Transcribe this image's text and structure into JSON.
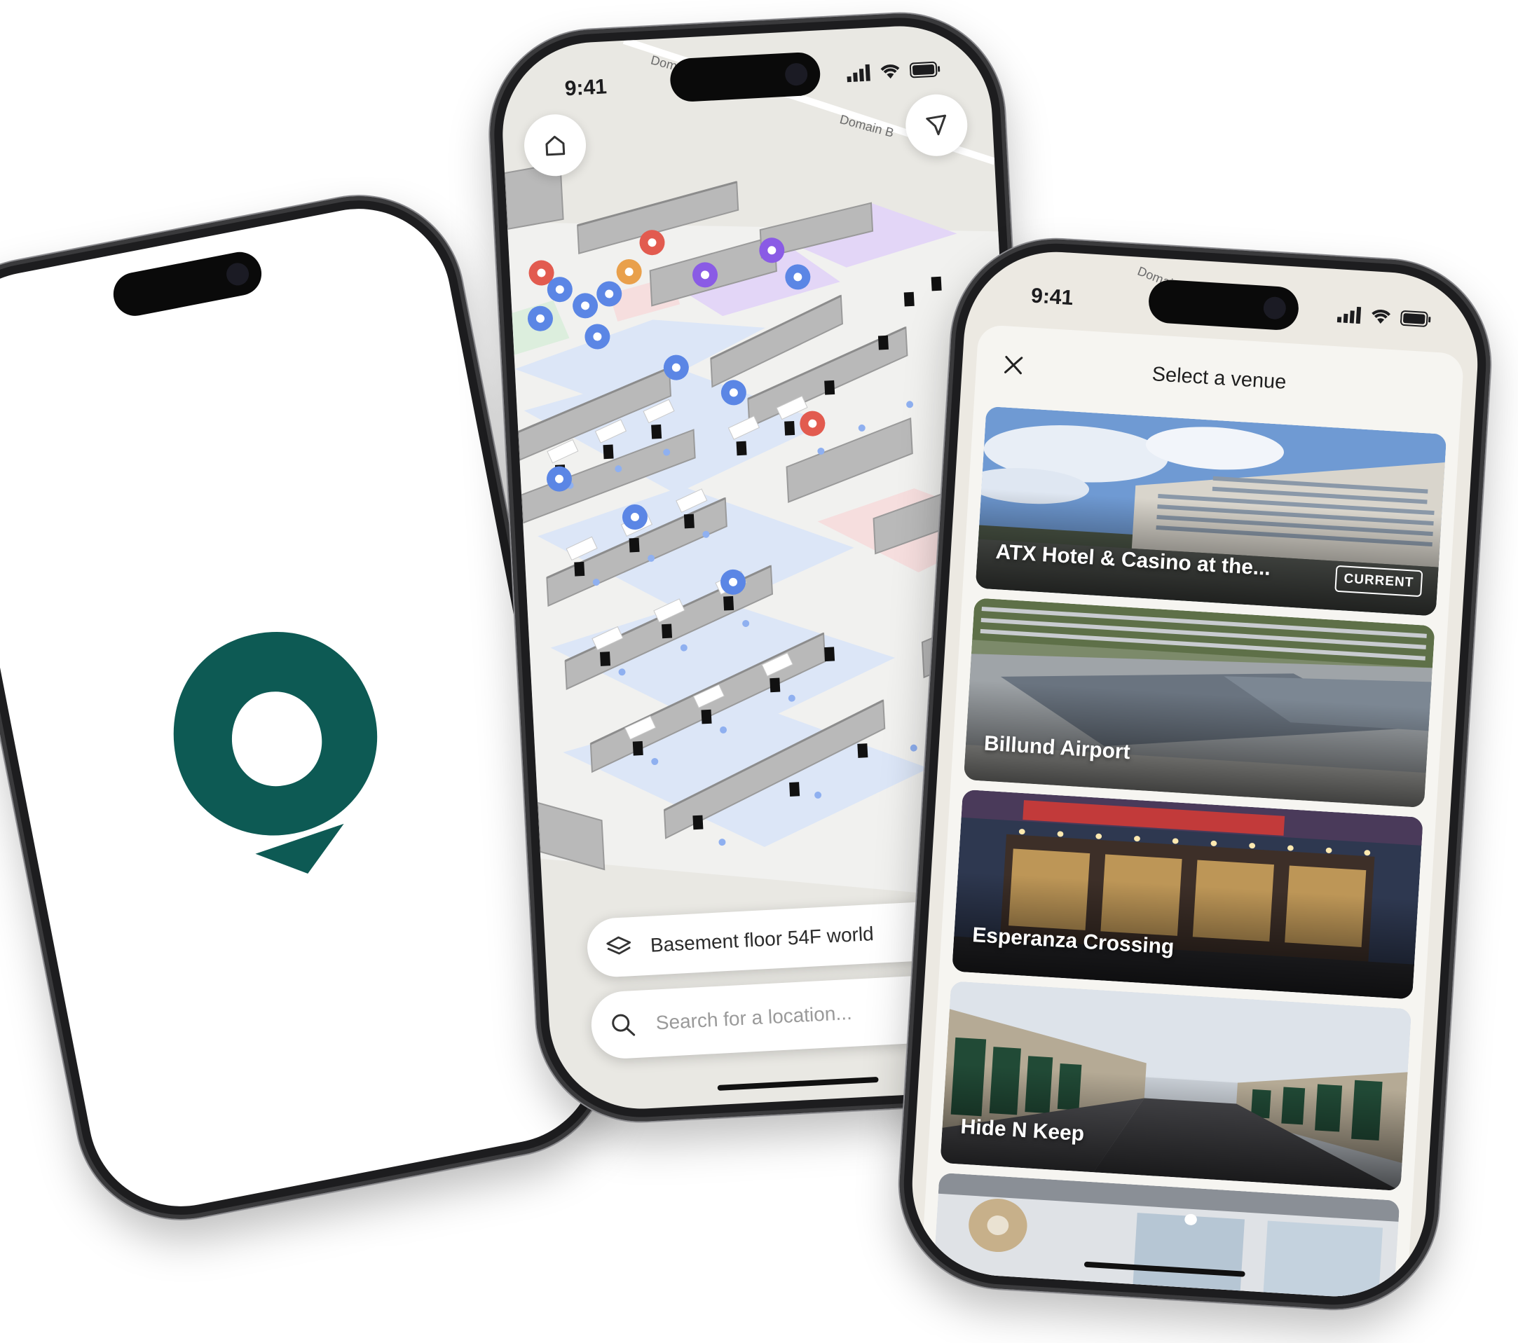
{
  "brand": {
    "logo_name": "pin-logo",
    "accent": "#0d5a54"
  },
  "map_phone": {
    "status_time": "9:41",
    "road_label": "Domain B",
    "road_label_2": "Domain Bl",
    "floor_label": "Basement floor 54F world",
    "search_placeholder": "Search for a location..."
  },
  "venue_phone": {
    "status_time": "9:41",
    "road_label": "Domain Bl",
    "title": "Select a venue",
    "current_badge": "CURRENT",
    "venues": [
      {
        "name": "ATX Hotel & Casino at the...",
        "current": true
      },
      {
        "name": "Billund Airport",
        "current": false
      },
      {
        "name": "Esperanza Crossing",
        "current": false
      },
      {
        "name": "Hide N Keep",
        "current": false
      },
      {
        "name": "",
        "current": false
      }
    ]
  },
  "colors": {
    "map_bg": "#e9e8e3",
    "wall": "#b9b9b9",
    "floor_blue": "#dce6f7",
    "room_purple": "#e3d6f7",
    "room_pink": "#f6dede",
    "room_green": "#dceedd",
    "poi_blue": "#5b86e5",
    "poi_red": "#e25b4f",
    "poi_purple": "#8a5be5",
    "poi_orange": "#e9a04b"
  }
}
